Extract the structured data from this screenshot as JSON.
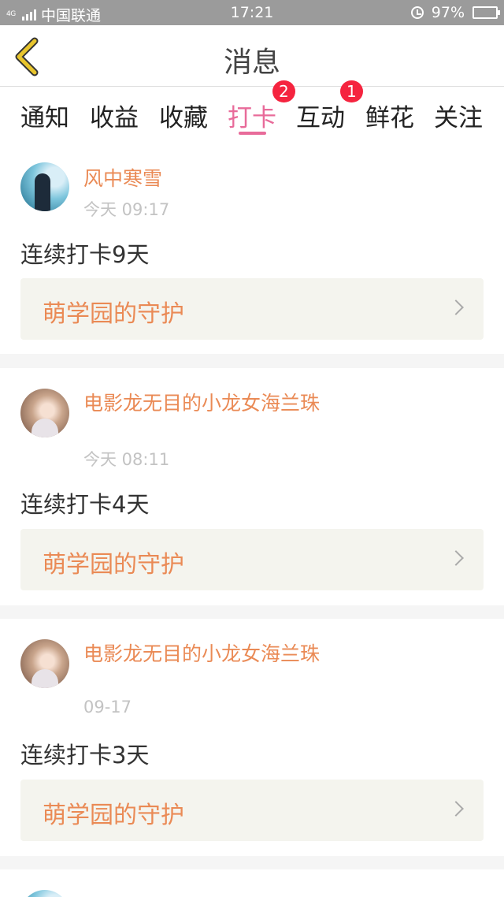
{
  "status_bar": {
    "network": "4G",
    "carrier": "中国联通",
    "time": "17:21",
    "battery": "97%",
    "battery_level": 0.97
  },
  "header": {
    "title": "消息",
    "back_icon": "chevron-left-icon",
    "accent_color": "#e8c52d"
  },
  "tabs": [
    {
      "label": "通知"
    },
    {
      "label": "收益"
    },
    {
      "label": "收藏"
    },
    {
      "label": "打卡",
      "badge": "2",
      "active": true
    },
    {
      "label": "互动",
      "badge": "1"
    },
    {
      "label": "鲜花"
    },
    {
      "label": "关注"
    }
  ],
  "colors": {
    "active_tab": "#e86b9a",
    "username": "#ea8a55",
    "badge": "#f5243f"
  },
  "feed": [
    {
      "username": "风中寒雪",
      "time": "今天 09:17",
      "message": "连续打卡9天",
      "guard": "萌学园的守护"
    },
    {
      "username": "电影龙无目的小龙女海兰珠",
      "time": "今天 08:11",
      "message": "连续打卡4天",
      "guard": "萌学园的守护"
    },
    {
      "username": "电影龙无目的小龙女海兰珠",
      "time": "09-17",
      "message": "连续打卡3天",
      "guard": "萌学园的守护"
    }
  ]
}
